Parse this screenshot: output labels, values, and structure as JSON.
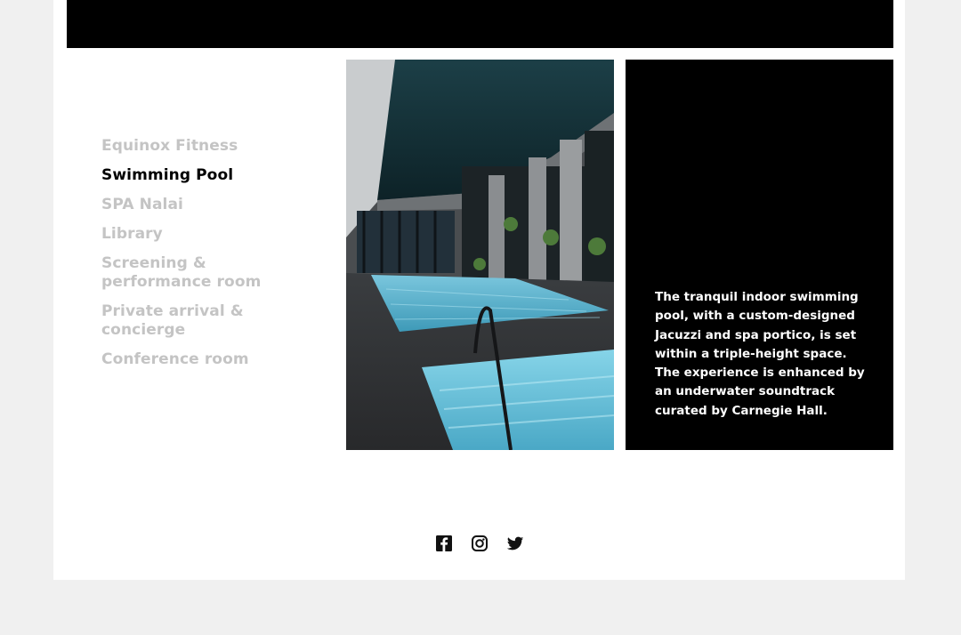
{
  "nav": {
    "items": [
      {
        "label": "Equinox Fitness",
        "active": false
      },
      {
        "label": "Swimming Pool",
        "active": true
      },
      {
        "label": "SPA Nalai",
        "active": false
      },
      {
        "label": "Library",
        "active": false
      },
      {
        "label": "Screening & performance room",
        "active": false
      },
      {
        "label": "Private arrival & concierge",
        "active": false
      },
      {
        "label": "Conference room",
        "active": false
      }
    ]
  },
  "feature": {
    "description": "The tranquil indoor swimming pool, with a custom-designed Jacuzzi and spa portico, is set within a triple-height space. The experience is enhanced by an underwater soundtrack curated by Carnegie Hall."
  },
  "social": {
    "icons": [
      "facebook-icon",
      "instagram-icon",
      "twitter-icon"
    ]
  },
  "colors": {
    "background": "#f0f0f0",
    "card": "#ffffff",
    "active_nav": "#000000",
    "inactive_nav": "#c4c4c4",
    "panel": "#000000",
    "water": "#5fb3cf"
  }
}
